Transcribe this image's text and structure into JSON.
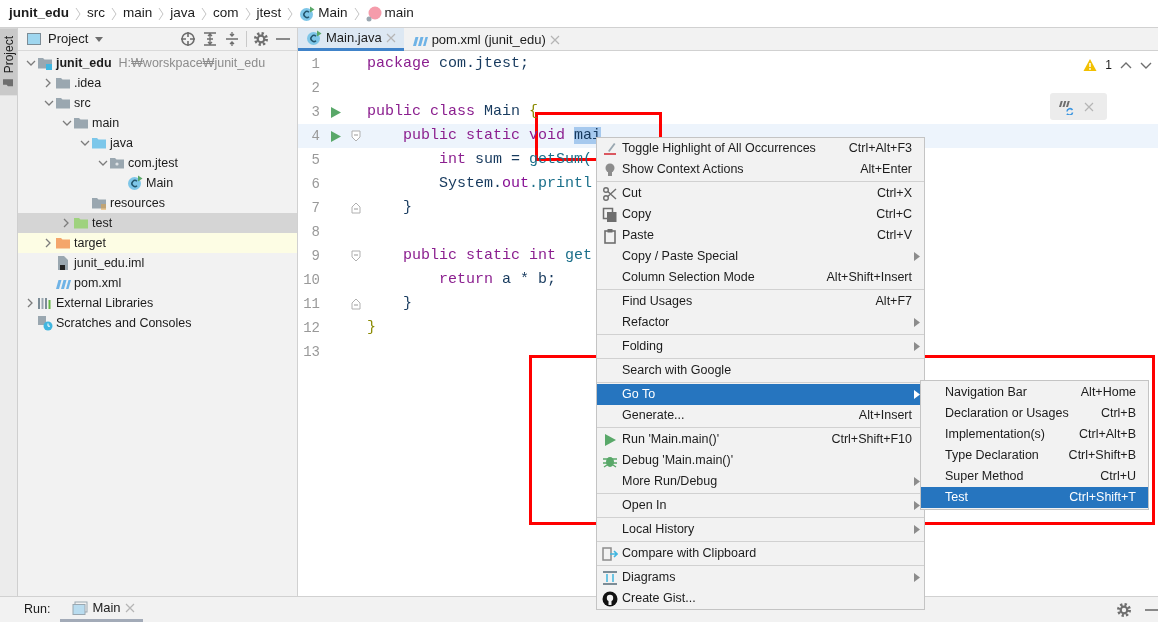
{
  "breadcrumbs": [
    {
      "label": "junit_edu",
      "kind": "module"
    },
    {
      "label": "src",
      "kind": "dir"
    },
    {
      "label": "main",
      "kind": "dir"
    },
    {
      "label": "java",
      "kind": "dir"
    },
    {
      "label": "com",
      "kind": "dir"
    },
    {
      "label": "jtest",
      "kind": "dir"
    },
    {
      "label": "Main",
      "kind": "class"
    },
    {
      "label": "main",
      "kind": "method"
    }
  ],
  "tool_window_tabs": [
    {
      "label": "Project",
      "selected": true
    }
  ],
  "project_panel": {
    "title": "Project"
  },
  "tree": [
    {
      "label": "junit_edu",
      "path": "H:₩worskpace₩junit_edu",
      "kind": "module",
      "expanded": true,
      "selected": false,
      "children": [
        {
          "label": ".idea",
          "kind": "folder",
          "expanded": false,
          "selected": false
        },
        {
          "label": "src",
          "kind": "folder",
          "expanded": true,
          "selected": false,
          "children": [
            {
              "label": "main",
              "kind": "folder",
              "expanded": true,
              "selected": false,
              "children": [
                {
                  "label": "java",
                  "kind": "source",
                  "expanded": true,
                  "selected": false,
                  "children": [
                    {
                      "label": "com.jtest",
                      "kind": "package",
                      "expanded": true,
                      "selected": false,
                      "children": [
                        {
                          "label": "Main",
                          "kind": "class",
                          "selected": false
                        }
                      ]
                    }
                  ]
                },
                {
                  "label": "resources",
                  "kind": "resources",
                  "selected": false
                }
              ]
            },
            {
              "label": "test",
              "kind": "test",
              "expanded": false,
              "selected": true
            }
          ]
        },
        {
          "label": "target",
          "kind": "excluded",
          "expanded": false,
          "selected": false,
          "highlighted": true
        },
        {
          "label": "junit_edu.iml",
          "kind": "modulefile",
          "selected": false
        },
        {
          "label": "pom.xml",
          "kind": "maven",
          "selected": false
        }
      ]
    },
    {
      "label": "External Libraries",
      "kind": "libraries",
      "expanded": false,
      "selected": false
    },
    {
      "label": "Scratches and Consoles",
      "kind": "scratches",
      "selected": false
    }
  ],
  "editor_tabs": [
    {
      "label": "Main.java",
      "kind": "class",
      "selected": true
    },
    {
      "label": "pom.xml (junit_edu)",
      "kind": "maven",
      "selected": false
    }
  ],
  "inspection": {
    "warnings": "1"
  },
  "code_lines": [
    {
      "number": "1",
      "run": false,
      "tokens": [
        {
          "text": "package",
          "kind": "keyword"
        },
        {
          "text": " com.jtest;",
          "kind": "plain"
        }
      ]
    },
    {
      "number": "2",
      "run": false
    },
    {
      "number": "3",
      "run": true,
      "tokens": [
        {
          "text": "public class",
          "kind": "keyword"
        },
        {
          "text": " Main ",
          "kind": "plain"
        },
        {
          "text": "{",
          "kind": "brace"
        }
      ]
    },
    {
      "number": "4",
      "run": true,
      "fold_start": true,
      "current": true,
      "tokens": [
        {
          "text": "    public static void ",
          "kind": "keyword"
        },
        {
          "text": "mai",
          "kind": "plain",
          "selected": true
        }
      ]
    },
    {
      "number": "5",
      "run": false,
      "tokens": [
        {
          "text": "        int",
          "kind": "keyword"
        },
        {
          "text": " sum = ",
          "kind": "plain"
        },
        {
          "text": "getSum(",
          "kind": "call"
        }
      ]
    },
    {
      "number": "6",
      "run": false,
      "tokens": [
        {
          "text": "        System.",
          "kind": "plain"
        },
        {
          "text": "out",
          "kind": "field"
        },
        {
          "text": ".printl",
          "kind": "call"
        }
      ]
    },
    {
      "number": "7",
      "run": false,
      "fold_end": true,
      "tokens": [
        {
          "text": "    }",
          "kind": "plain"
        }
      ]
    },
    {
      "number": "8",
      "run": false
    },
    {
      "number": "9",
      "run": false,
      "fold_start": true,
      "tokens": [
        {
          "text": "    public static int ",
          "kind": "keyword"
        },
        {
          "text": "get",
          "kind": "call"
        }
      ]
    },
    {
      "number": "10",
      "run": false,
      "tokens": [
        {
          "text": "        return",
          "kind": "keyword"
        },
        {
          "text": " a * b;",
          "kind": "plain"
        }
      ]
    },
    {
      "number": "11",
      "run": false,
      "fold_end": true,
      "tokens": [
        {
          "text": "    }",
          "kind": "plain"
        }
      ]
    },
    {
      "number": "12",
      "run": false,
      "tokens": [
        {
          "text": "}",
          "kind": "brace"
        }
      ]
    },
    {
      "number": "13",
      "run": false
    }
  ],
  "context_menu": [
    {
      "kind": "highlight",
      "label": "Toggle Highlight of All Occurrences",
      "shortcut": "Ctrl+Alt+F3",
      "submenu": false,
      "selected": false
    },
    {
      "kind": "bulb",
      "label": "Show Context Actions",
      "shortcut": "Alt+Enter",
      "submenu": false,
      "selected": false
    },
    {
      "kind": "separator"
    },
    {
      "kind": "cut",
      "label": "Cut",
      "shortcut": "Ctrl+X",
      "submenu": false,
      "selected": false
    },
    {
      "kind": "copy",
      "label": "Copy",
      "shortcut": "Ctrl+C",
      "submenu": false,
      "selected": false
    },
    {
      "kind": "paste",
      "label": "Paste",
      "shortcut": "Ctrl+V",
      "submenu": false,
      "selected": false
    },
    {
      "kind": "item",
      "label": "Copy / Paste Special",
      "submenu": true,
      "selected": false
    },
    {
      "kind": "item",
      "label": "Column Selection Mode",
      "shortcut": "Alt+Shift+Insert",
      "submenu": false,
      "selected": false
    },
    {
      "kind": "separator"
    },
    {
      "kind": "item",
      "label": "Find Usages",
      "shortcut": "Alt+F7",
      "submenu": false,
      "selected": false
    },
    {
      "kind": "item",
      "label": "Refactor",
      "submenu": true,
      "selected": false
    },
    {
      "kind": "separator"
    },
    {
      "kind": "item",
      "label": "Folding",
      "submenu": true,
      "selected": false
    },
    {
      "kind": "separator"
    },
    {
      "kind": "item",
      "label": "Search with Google",
      "submenu": false,
      "selected": false
    },
    {
      "kind": "separator"
    },
    {
      "kind": "item",
      "label": "Go To",
      "submenu": true,
      "selected": true
    },
    {
      "kind": "item",
      "label": "Generate...",
      "shortcut": "Alt+Insert",
      "submenu": false,
      "selected": false
    },
    {
      "kind": "separator"
    },
    {
      "kind": "run",
      "label": "Run 'Main.main()'",
      "shortcut": "Ctrl+Shift+F10",
      "submenu": false,
      "selected": false
    },
    {
      "kind": "debug",
      "label": "Debug 'Main.main()'",
      "submenu": false,
      "selected": false
    },
    {
      "kind": "item",
      "label": "More Run/Debug",
      "submenu": true,
      "selected": false
    },
    {
      "kind": "separator"
    },
    {
      "kind": "item",
      "label": "Open In",
      "submenu": true,
      "selected": false
    },
    {
      "kind": "separator"
    },
    {
      "kind": "item",
      "label": "Local History",
      "submenu": true,
      "selected": false
    },
    {
      "kind": "separator"
    },
    {
      "kind": "compare",
      "label": "Compare with Clipboard",
      "submenu": false,
      "selected": false
    },
    {
      "kind": "separator"
    },
    {
      "kind": "diagrams",
      "label": "Diagrams",
      "submenu": true,
      "selected": false
    },
    {
      "kind": "gist",
      "label": "Create Gist...",
      "submenu": false,
      "selected": false
    }
  ],
  "submenu": [
    {
      "label": "Navigation Bar",
      "shortcut": "Alt+Home",
      "selected": false
    },
    {
      "label": "Declaration or Usages",
      "shortcut": "Ctrl+B",
      "selected": false
    },
    {
      "label": "Implementation(s)",
      "shortcut": "Ctrl+Alt+B",
      "selected": false
    },
    {
      "label": "Type Declaration",
      "shortcut": "Ctrl+Shift+B",
      "selected": false
    },
    {
      "label": "Super Method",
      "shortcut": "Ctrl+U",
      "selected": false
    },
    {
      "label": "Test",
      "shortcut": "Ctrl+Shift+T",
      "selected": true
    }
  ],
  "run_bar": {
    "label": "Run:",
    "tabs": [
      {
        "label": "Main",
        "selected": true
      }
    ]
  }
}
